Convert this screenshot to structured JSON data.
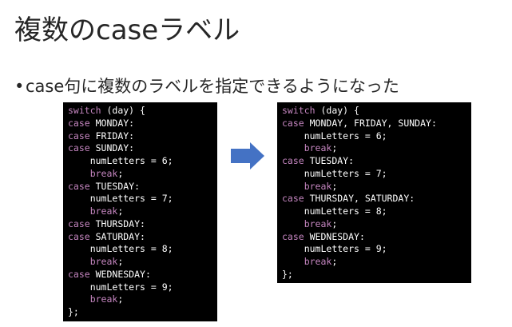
{
  "slide": {
    "title": "複数のcaseラベル",
    "bullet": {
      "marker": "•",
      "text": "case句に複数のラベルを指定できるようになった"
    }
  },
  "colors": {
    "code_background": "#000000",
    "keyword": "#c586c0",
    "code_text": "#ffffff",
    "arrow": "#4472c4"
  },
  "icons": {
    "arrow": "right-arrow-icon"
  },
  "code_before": [
    {
      "indent": "",
      "keyword": "switch",
      "rest": " (day) {"
    },
    {
      "indent": "",
      "keyword": "case",
      "rest": " MONDAY:"
    },
    {
      "indent": "",
      "keyword": "case",
      "rest": " FRIDAY:"
    },
    {
      "indent": "",
      "keyword": "case",
      "rest": " SUNDAY:"
    },
    {
      "indent": "    ",
      "keyword": "",
      "rest": "numLetters = 6;"
    },
    {
      "indent": "    ",
      "keyword": "break",
      "rest": ";"
    },
    {
      "indent": "",
      "keyword": "case",
      "rest": " TUESDAY:"
    },
    {
      "indent": "    ",
      "keyword": "",
      "rest": "numLetters = 7;"
    },
    {
      "indent": "    ",
      "keyword": "break",
      "rest": ";"
    },
    {
      "indent": "",
      "keyword": "case",
      "rest": " THURSDAY:"
    },
    {
      "indent": "",
      "keyword": "case",
      "rest": " SATURDAY:"
    },
    {
      "indent": "    ",
      "keyword": "",
      "rest": "numLetters = 8;"
    },
    {
      "indent": "    ",
      "keyword": "break",
      "rest": ";"
    },
    {
      "indent": "",
      "keyword": "case",
      "rest": " WEDNESDAY:"
    },
    {
      "indent": "    ",
      "keyword": "",
      "rest": "numLetters = 9;"
    },
    {
      "indent": "    ",
      "keyword": "break",
      "rest": ";"
    },
    {
      "indent": "",
      "keyword": "",
      "rest": "};"
    }
  ],
  "code_after": [
    {
      "indent": "",
      "keyword": "switch",
      "rest": " (day) {"
    },
    {
      "indent": "",
      "keyword": "case",
      "rest": " MONDAY, FRIDAY, SUNDAY:"
    },
    {
      "indent": "    ",
      "keyword": "",
      "rest": "numLetters = 6;"
    },
    {
      "indent": "    ",
      "keyword": "break",
      "rest": ";"
    },
    {
      "indent": "",
      "keyword": "case",
      "rest": " TUESDAY:"
    },
    {
      "indent": "    ",
      "keyword": "",
      "rest": "numLetters = 7;"
    },
    {
      "indent": "    ",
      "keyword": "break",
      "rest": ";"
    },
    {
      "indent": "",
      "keyword": "case",
      "rest": " THURSDAY, SATURDAY:"
    },
    {
      "indent": "    ",
      "keyword": "",
      "rest": "numLetters = 8;"
    },
    {
      "indent": "    ",
      "keyword": "break",
      "rest": ";"
    },
    {
      "indent": "",
      "keyword": "case",
      "rest": " WEDNESDAY:"
    },
    {
      "indent": "    ",
      "keyword": "",
      "rest": "numLetters = 9;"
    },
    {
      "indent": "    ",
      "keyword": "break",
      "rest": ";"
    },
    {
      "indent": "",
      "keyword": "",
      "rest": "};"
    }
  ]
}
